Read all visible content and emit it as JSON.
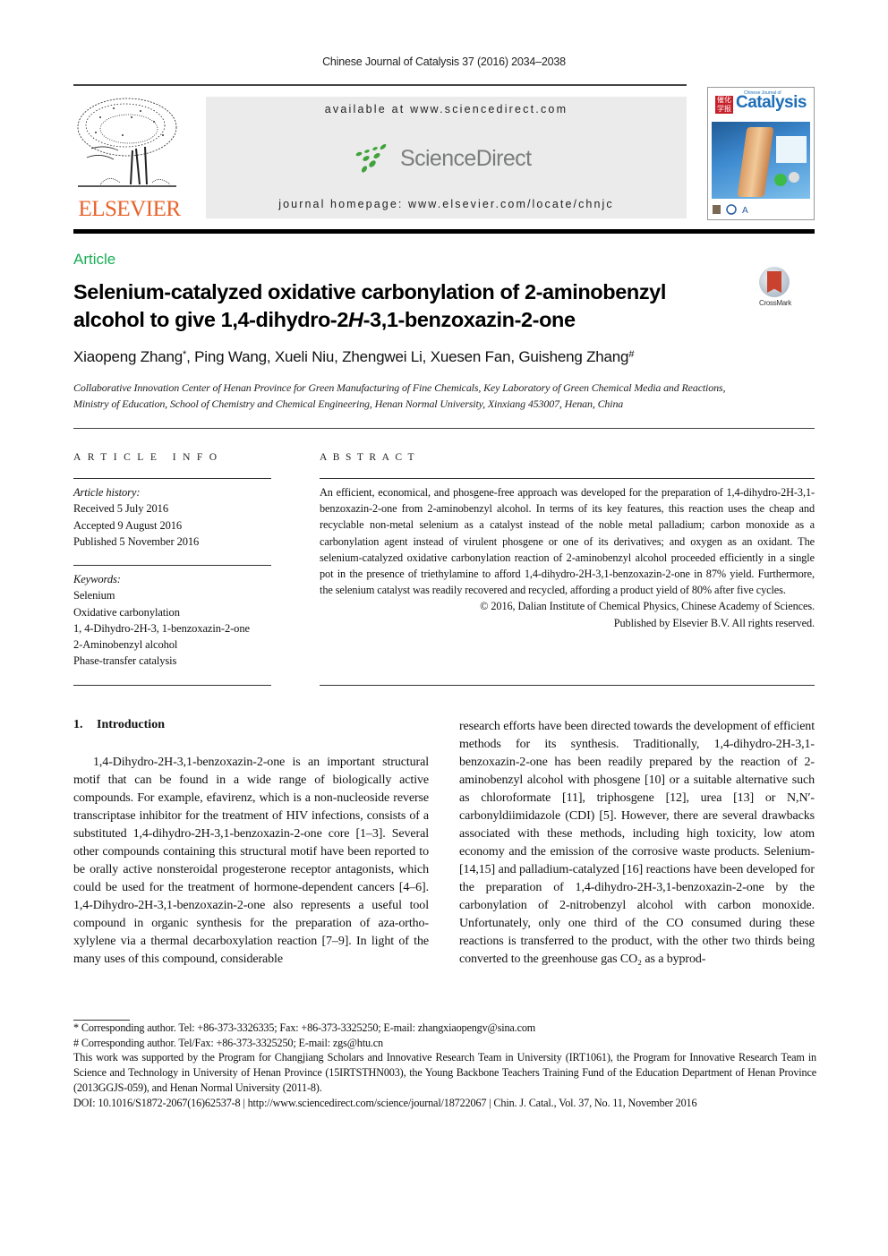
{
  "header": {
    "journal_citation": "Chinese Journal of Catalysis 37 (2016) 2034–2038",
    "publisher_logo_text": "ELSEVIER",
    "available_at": "available at www.sciencedirect.com",
    "sciencedirect_logo_text": "ScienceDirect",
    "journal_homepage": "journal homepage: www.elsevier.com/locate/chnjc",
    "cover": {
      "title": "Catalysis",
      "subtitle": "Chinese Journal of",
      "chinese_mark": "催化学报"
    },
    "colors": {
      "elsevier_orange": "#e8622a",
      "sciencedirect_green": "#3fa23a",
      "article_green": "#1aae56",
      "banner_gray": "#ebebeb"
    }
  },
  "article": {
    "type_label": "Article",
    "title_line1": "Selenium-catalyzed oxidative carbonylation of 2-aminobenzyl",
    "title_line2_pre": "alcohol to give 1,4-dihydro-2",
    "title_line2_italic": "H",
    "title_line2_post": "-3,1-benzoxazin-2-one",
    "crossmark_label": "CrossMark",
    "authors": {
      "a1": "Xiaopeng Zhang",
      "a1_mark": "*",
      "rest": ", Ping Wang, Xueli Niu, Zhengwei Li, Xuesen Fan, Guisheng Zhang",
      "last_mark": "#"
    },
    "affiliation_line1": "Collaborative Innovation Center of Henan Province for Green Manufacturing of Fine Chemicals, Key Laboratory of Green Chemical Media and Reactions,",
    "affiliation_line2": "Ministry of Education, School of Chemistry and Chemical Engineering, Henan Normal University, Xinxiang 453007, Henan, China"
  },
  "article_info": {
    "heading": "ARTICLE INFO",
    "history_label": "Article history:",
    "history": [
      "Received 5 July 2016",
      "Accepted 9 August 2016",
      "Published 5 November 2016"
    ],
    "keywords_label": "Keywords:",
    "keywords": [
      "Selenium",
      "Oxidative carbonylation",
      "1, 4-Dihydro-2H-3, 1-benzoxazin-2-one",
      "2-Aminobenzyl alcohol",
      "Phase-transfer catalysis"
    ]
  },
  "abstract": {
    "heading": "ABSTRACT",
    "text": "An efficient, economical, and phosgene-free approach was developed for the preparation of 1,4-dihydro-2H-3,1-benzoxazin-2-one from 2-aminobenzyl alcohol. In terms of its key features, this reaction uses the cheap and recyclable non-metal selenium as a catalyst instead of the noble metal palladium; carbon monoxide as a carbonylation agent instead of virulent phosgene or one of its derivatives; and oxygen as an oxidant. The selenium-catalyzed oxidative carbonylation reaction of 2-aminobenzyl alcohol proceeded efficiently in a single pot in the presence of triethylamine to afford 1,4-dihydro-2H-3,1-benzoxazin-2-one in 87% yield. Furthermore, the selenium catalyst was readily recovered and recycled, affording a product yield of 80% after five cycles.",
    "copyright_line1": "© 2016, Dalian Institute of Chemical Physics, Chinese Academy of Sciences.",
    "copyright_line2": "Published by Elsevier B.V. All rights reserved."
  },
  "introduction": {
    "number": "1.",
    "heading": "Introduction",
    "column1": "1,4-Dihydro-2H-3,1-benzoxazin-2-one is an important structural motif that can be found in a wide range of biologically active compounds. For example, efavirenz, which is a non-nucleoside reverse transcriptase inhibitor for the treatment of HIV infections, consists of a substituted 1,4-dihydro-2H-3,1-benzoxazin-2-one core [1–3]. Several other compounds containing this structural motif have been reported to be orally active nonsteroidal progesterone receptor antagonists, which could be used for the treatment of hormone-dependent cancers [4–6]. 1,4-Dihydro-2H-3,1-benzoxazin-2-one also represents a useful tool compound in organic synthesis for the preparation of aza-ortho-xylylene via a thermal decarboxylation reaction [7–9]. In light of the many uses of this compound, considerable",
    "column2": "research efforts have been directed towards the development of efficient methods for its synthesis. Traditionally, 1,4-dihydro-2H-3,1-benzoxazin-2-one has been readily prepared by the reaction of 2-aminobenzyl alcohol with phosgene [10] or a suitable alternative such as chloroformate [11], triphosgene [12], urea [13] or N,N′-carbonyldiimidazole (CDI) [5]. However, there are several drawbacks associated with these methods, including high toxicity, low atom economy and the emission of the corrosive waste products. Selenium- [14,15] and palladium-catalyzed [16] reactions have been developed for the preparation of 1,4-dihydro-2H-3,1-benzoxazin-2-one by the carbonylation of 2-nitrobenzyl alcohol with carbon monoxide. Unfortunately, only one third of the CO consumed during these reactions is transferred to the product, with the other two thirds being converted to the greenhouse gas CO₂ as a byprod-"
  },
  "footnotes": {
    "corresponding1": "* Corresponding author. Tel: +86-373-3326335; Fax: +86-373-3325250; E-mail: zhangxiaopengv@sina.com",
    "corresponding2": "# Corresponding author. Tel/Fax: +86-373-3325250; E-mail: zgs@htu.cn",
    "funding": "This work was supported by the Program for Changjiang Scholars and Innovative Research Team in University (IRT1061), the Program for Innovative Research Team in Science and Technology in University of Henan Province (15IRTSTHN003), the Young Backbone Teachers Training Fund of the Education Department of Henan Province (2013GGJS-059), and Henan Normal University (2011-8).",
    "doi_line": "DOI: 10.1016/S1872-2067(16)62537-8 | http://www.sciencedirect.com/science/journal/18722067 | Chin. J. Catal., Vol. 37, No. 11, November 2016"
  }
}
